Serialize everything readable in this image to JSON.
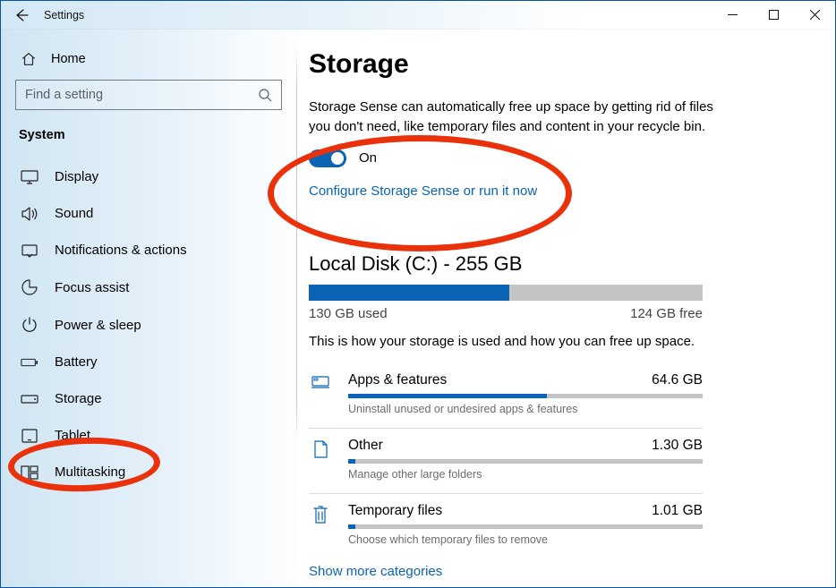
{
  "window": {
    "title": "Settings"
  },
  "sidebar": {
    "home": "Home",
    "search_placeholder": "Find a setting",
    "group": "System",
    "items": [
      {
        "label": "Display"
      },
      {
        "label": "Sound"
      },
      {
        "label": "Notifications & actions"
      },
      {
        "label": "Focus assist"
      },
      {
        "label": "Power & sleep"
      },
      {
        "label": "Battery"
      },
      {
        "label": "Storage"
      },
      {
        "label": "Tablet"
      },
      {
        "label": "Multitasking"
      }
    ]
  },
  "page": {
    "title": "Storage",
    "sense_desc": "Storage Sense can automatically free up space by getting rid of files you don't need, like temporary files and content in your recycle bin.",
    "toggle_state": "On",
    "configure_link": "Configure Storage Sense or run it now",
    "disk_heading": "Local Disk (C:) - 255 GB",
    "disk_used_pct": 51,
    "disk_used_label": "130 GB used",
    "disk_free_label": "124 GB free",
    "disk_desc": "This is how your storage is used and how you can free up space.",
    "categories": [
      {
        "name": "Apps & features",
        "size": "64.6 GB",
        "pct": 56,
        "sub": "Uninstall unused or undesired apps & features"
      },
      {
        "name": "Other",
        "size": "1.30 GB",
        "pct": 2,
        "sub": "Manage other large folders"
      },
      {
        "name": "Temporary files",
        "size": "1.01 GB",
        "pct": 2,
        "sub": "Choose which temporary files to remove"
      }
    ],
    "more_link": "Show more categories"
  }
}
